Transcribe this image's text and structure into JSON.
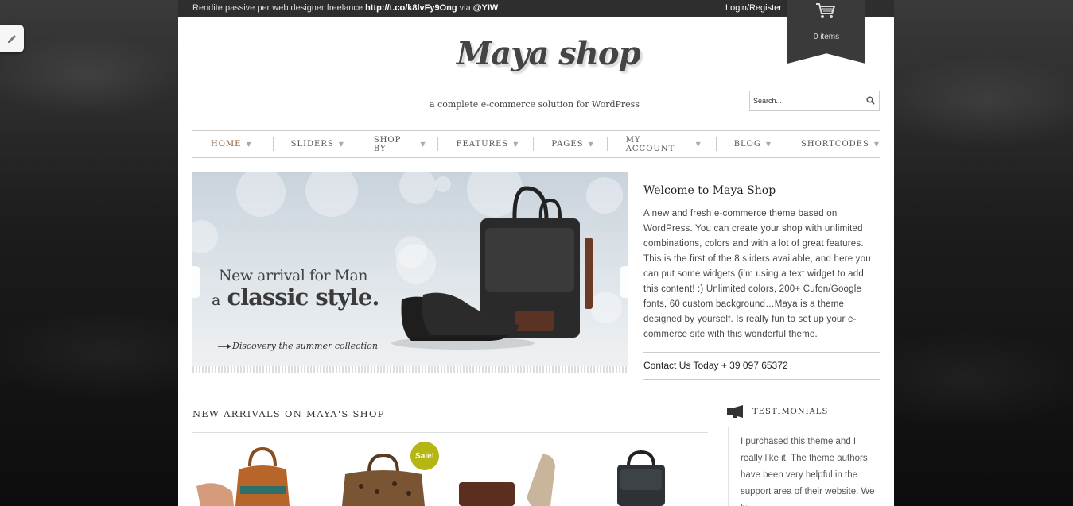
{
  "topbar": {
    "ticker_prefix": "Rendite passive per web designer freelance",
    "ticker_link": "http://t.co/k8lvFy9Ong",
    "ticker_via": "via",
    "ticker_handle": "@YIW",
    "login_label": "Login/Register"
  },
  "cart": {
    "icon": "cart-icon",
    "items_label": "0 items"
  },
  "header": {
    "logo_text": "Maya shop",
    "tagline": "a complete e-commerce solution for WordPress"
  },
  "search": {
    "placeholder": "Search..."
  },
  "nav": {
    "items": [
      {
        "label": "HOME"
      },
      {
        "label": "SLIDERS"
      },
      {
        "label": "SHOP BY"
      },
      {
        "label": "FEATURES"
      },
      {
        "label": "PAGES"
      },
      {
        "label": "MY ACCOUNT"
      },
      {
        "label": "BLOG"
      },
      {
        "label": "SHORTCODES"
      }
    ]
  },
  "slider": {
    "headline_line1": "New arrival for Man",
    "headline_prefix": "a",
    "headline_line2": "classic style.",
    "discovery_text": "Discovery the summer collection"
  },
  "welcome": {
    "title": "Welcome to Maya Shop",
    "body": "A new and fresh e-commerce theme based on WordPress. You can create your shop with unlimited combinations, colors and with a lot of great features. This is the first of the 8 sliders available, and here you can put some widgets (i’m using a text widget to add this content! :) Unlimited colors, 200+ Cufon/Google fonts, 60 custom background…Maya is a theme designed by yourself. Is really fun to set up your e-commerce site with this wonderful theme.",
    "contact": "Contact Us Today + 39 097 65372"
  },
  "arrivals": {
    "title": "NEW ARRIVALS ON MAYA'S SHOP",
    "sale_badge": "Sale!"
  },
  "testimonials": {
    "title": "TESTIMONIALS",
    "text": "I purchased this theme and I really like it. The theme authors have been very helpful in the support area of their website. We hi"
  },
  "colors": {
    "accent": "#8a5a33",
    "topbar": "#2e2e2e",
    "sale": "#b5b514"
  }
}
